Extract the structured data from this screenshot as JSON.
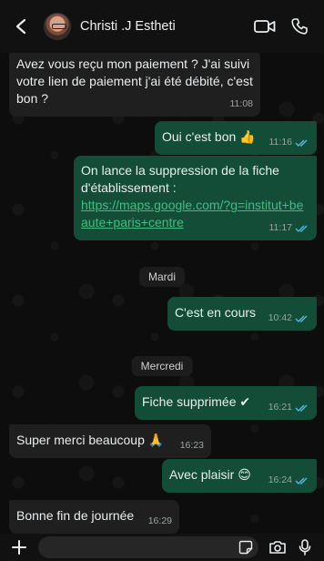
{
  "header": {
    "contact_name": "Christi .J Estheti"
  },
  "days": {
    "mardi": "Mardi",
    "mercredi": "Mercredi"
  },
  "messages": [
    {
      "dir": "in",
      "text": "Avez vous reçu mon paiement ? J'ai suivi votre lien de paiement j'ai été débité, c'est bon ?",
      "time": "11:08"
    },
    {
      "dir": "out",
      "text": "Oui c'est bon 👍",
      "time": "11:16",
      "status": "read"
    },
    {
      "dir": "out",
      "text": "On lance la suppression de la fiche d'établissement :",
      "link": "https://maps.google.com/?g=institut+beaute+paris+centre",
      "time": "11:17",
      "status": "read"
    },
    {
      "dir": "out",
      "text": "C'est en cours",
      "time": "10:42",
      "status": "read"
    },
    {
      "dir": "out",
      "text": "Fiche supprimée ✔",
      "time": "16:21",
      "status": "read"
    },
    {
      "dir": "in",
      "text": "Super merci beaucoup 🙏",
      "time": "16:23"
    },
    {
      "dir": "out",
      "text": "Avec plaisir 😊",
      "time": "16:24",
      "status": "read"
    },
    {
      "dir": "in",
      "text": "Bonne fin de journée",
      "time": "16:29"
    }
  ],
  "colors": {
    "outgoing_bubble": "#144d37",
    "incoming_bubble": "#1f1f1f",
    "read_ticks": "#53bdeb"
  },
  "icons": [
    "back-arrow-icon",
    "video-call-icon",
    "phone-icon",
    "plus-icon",
    "sticker-icon",
    "camera-icon",
    "microphone-icon",
    "double-check-icon"
  ]
}
